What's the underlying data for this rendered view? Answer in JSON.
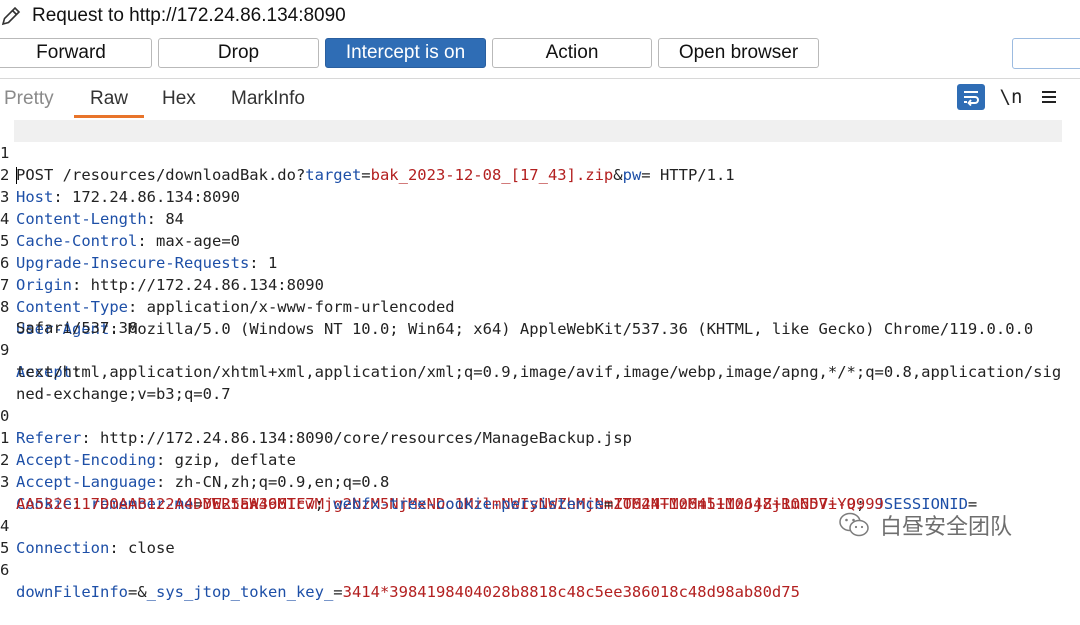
{
  "window": {
    "title": "Request to http://172.24.86.134:8090"
  },
  "toolbar": {
    "forward": "Forward",
    "drop": "Drop",
    "intercept": "Intercept is on",
    "action": "Action",
    "open_browser": "Open browser",
    "search_value": ""
  },
  "tabs": [
    "Pretty",
    "Raw",
    "Hex",
    "MarkInfo"
  ],
  "active_tab": "Raw",
  "icons": {
    "wrap": "wrap-lines-icon",
    "newline": "\\n",
    "menu": "hamburger-menu-icon",
    "edit": "pencil-icon"
  },
  "colors": {
    "accent": "#2f6db5",
    "tab_underline": "#e8742a",
    "key": "#1d4fa7",
    "value": "#b32020"
  },
  "editor": {
    "line_numbers": [
      "1",
      "2",
      "3",
      "4",
      "5",
      "6",
      "7",
      "8",
      "9",
      "0",
      "1",
      "2",
      "3",
      "4",
      "5",
      "6"
    ],
    "request_line": {
      "method_path": "POST /resources/downloadBak.do?",
      "p1_key": "target",
      "p1_val": "bak_2023-12-08_[17_43].zip",
      "amp": "&",
      "p2_key": "pw",
      "tail": "= HTTP/1.1"
    },
    "headers": [
      {
        "name": "Host",
        "value": "172.24.86.134:8090"
      },
      {
        "name": "Content-Length",
        "value": "84"
      },
      {
        "name": "Cache-Control",
        "value": "max-age=0"
      },
      {
        "name": "Upgrade-Insecure-Requests",
        "value": "1"
      },
      {
        "name": "Origin",
        "value": "http://172.24.86.134:8090"
      },
      {
        "name": "Content-Type",
        "value": "application/x-www-form-urlencoded"
      },
      {
        "name": "User-Agent",
        "value": "Mozilla/5.0 (Windows NT 10.0; Win64; x64) AppleWebKit/537.36 (KHTML, like Gecko) Chrome/119.0.0.0",
        "cont": "Safari/537.36"
      },
      {
        "name": "Accept",
        "value": "",
        "cont": "text/html,application/xhtml+xml,application/xml;q=0.9,image/avif,image/webp,image/apng,*/*;q=0.8,application/sig",
        "cont2": "ned-exchange;v=b3;q=0.7"
      },
      {
        "name": "Referer",
        "value": "http://172.24.86.134:8090/core/resources/ManageBackup.jsp"
      },
      {
        "name": "Accept-Encoding",
        "value": "gzip, deflate"
      },
      {
        "name": "Accept-Language",
        "value": "zh-CN,zh;q=0.9,en;q=0.8"
      }
    ],
    "cookie": {
      "name": "Cookie",
      "c1_key": "remember-me",
      "c1_val": "YWRtaW46MTcwMjg2NzM5NjMxNDo1MzlmNWIyNWZhMjNmZTM2NTMzMml1MzJjZjRmNDViYQ",
      "c2_key": "JSESSIONID",
      "c2_val": "AA532C117D0AAB122A4DDE25EA3961F7",
      "c3_key": "webfx-tree-cookie-persistence",
      "c3_val": "10644+10645+10648+10657+-9999"
    },
    "connection": {
      "name": "Connection",
      "value": "close"
    },
    "body": {
      "k1": "downFileInfo",
      "eq_amp": "=&",
      "k2": "_sys_jtop_token_key_",
      "v2": "3414*3984198404028b8818c48c5ee386018c48d98ab80d75"
    }
  },
  "watermark": {
    "text": "白昼安全团队"
  }
}
